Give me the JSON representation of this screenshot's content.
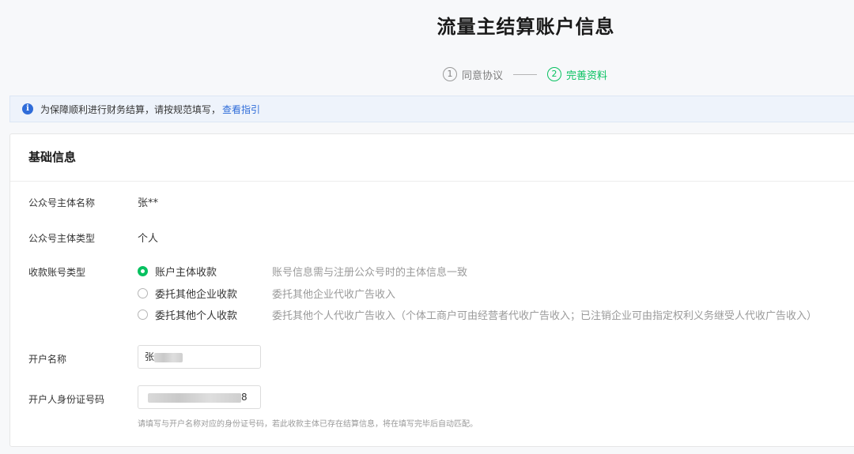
{
  "page": {
    "title": "流量主结算账户信息"
  },
  "steps": [
    {
      "num": "1",
      "label": "同意协议",
      "state": "done"
    },
    {
      "num": "2",
      "label": "完善资料",
      "state": "active"
    }
  ],
  "notice": {
    "icon": "info-icon",
    "text": "为保障顺利进行财务结算，请按规范填写，",
    "link": "查看指引"
  },
  "section": {
    "title": "基础信息",
    "fields": {
      "entity_name": {
        "label": "公众号主体名称",
        "value": "张**"
      },
      "entity_type": {
        "label": "公众号主体类型",
        "value": "个人"
      },
      "account_type": {
        "label": "收款账号类型",
        "options": [
          {
            "label": "账户主体收款",
            "desc": "账号信息需与注册公众号时的主体信息一致",
            "checked": true
          },
          {
            "label": "委托其他企业收款",
            "desc": "委托其他企业代收广告收入",
            "checked": false
          },
          {
            "label": "委托其他个人收款",
            "desc": "委托其他个人代收广告收入（个体工商户可由经营者代收广告收入；已注销企业可由指定权利义务继受人代收广告收入）",
            "checked": false
          }
        ]
      },
      "account_name": {
        "label": "开户名称",
        "value": "张"
      },
      "id_number": {
        "label": "开户人身份证号码",
        "value": "8"
      },
      "id_hint": "请填写与开户名称对应的身份证号码，若此收款主体已存在结算信息，将在填写完毕后自动匹配。"
    }
  },
  "colors": {
    "accent": "#07c160",
    "link": "#2f6cd9",
    "notice_bg": "#eef3fb"
  }
}
